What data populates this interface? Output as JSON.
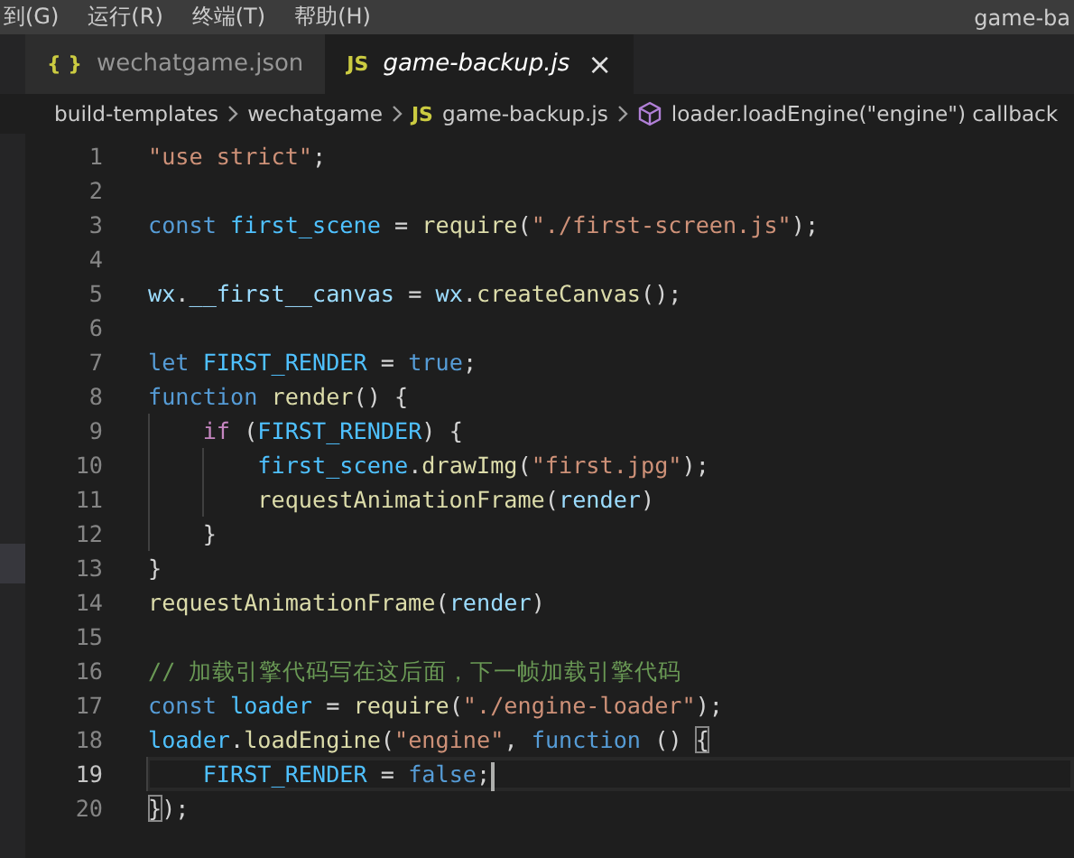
{
  "menu_bar": {
    "items": [
      "到(G)",
      "运行(R)",
      "终端(T)",
      "帮助(H)"
    ],
    "title": "game-ba"
  },
  "tabs": [
    {
      "icon": "{ }",
      "label": "wechatgame.json",
      "selected": false,
      "preview": false
    },
    {
      "icon": "JS",
      "label": "game-backup.js",
      "selected": true,
      "preview": true,
      "close": "×"
    }
  ],
  "breadcrumbs": [
    {
      "kind": "folder",
      "text": "build-templates"
    },
    {
      "kind": "folder",
      "text": "wechatgame"
    },
    {
      "kind": "file",
      "icon": "JS",
      "text": "game-backup.js"
    },
    {
      "kind": "symbol",
      "text": "loader.loadEngine(\"engine\") callback"
    }
  ],
  "editor": {
    "lines": [
      {
        "number": "1",
        "current": false,
        "tokens": [
          {
            "kind": "string",
            "text": "\"use strict\""
          },
          {
            "kind": "plain",
            "text": ";"
          }
        ]
      },
      {
        "number": "2",
        "current": false
      },
      {
        "number": "3",
        "current": false,
        "tokens": [
          {
            "kind": "keyword",
            "text": "const "
          },
          {
            "kind": "constant",
            "text": "first_scene"
          },
          {
            "kind": "plain",
            "text": " = "
          },
          {
            "kind": "function",
            "text": "require"
          },
          {
            "kind": "plain",
            "text": "("
          },
          {
            "kind": "string",
            "text": "\"./first-screen.js\""
          },
          {
            "kind": "plain",
            "text": ");"
          }
        ]
      },
      {
        "number": "4",
        "current": false
      },
      {
        "number": "5",
        "current": false,
        "tokens": [
          {
            "kind": "variable",
            "text": "wx"
          },
          {
            "kind": "plain",
            "text": "."
          },
          {
            "kind": "variable",
            "text": "__first__canvas"
          },
          {
            "kind": "plain",
            "text": " = "
          },
          {
            "kind": "variable",
            "text": "wx"
          },
          {
            "kind": "plain",
            "text": "."
          },
          {
            "kind": "function",
            "text": "createCanvas"
          },
          {
            "kind": "plain",
            "text": "();"
          }
        ]
      },
      {
        "number": "6",
        "current": false
      },
      {
        "number": "7",
        "current": false,
        "tokens": [
          {
            "kind": "keyword",
            "text": "let "
          },
          {
            "kind": "constant",
            "text": "FIRST_RENDER"
          },
          {
            "kind": "plain",
            "text": " = "
          },
          {
            "kind": "keyword",
            "text": "true"
          },
          {
            "kind": "plain",
            "text": ";"
          }
        ]
      },
      {
        "number": "8",
        "current": false,
        "tokens": [
          {
            "kind": "keyword",
            "text": "function "
          },
          {
            "kind": "function",
            "text": "render"
          },
          {
            "kind": "plain",
            "text": "() {"
          }
        ]
      },
      {
        "number": "9",
        "current": false,
        "tokens": [
          {
            "kind": "control",
            "text": "    if"
          },
          {
            "kind": "plain",
            "text": " ("
          },
          {
            "kind": "constant",
            "text": "FIRST_RENDER"
          },
          {
            "kind": "plain",
            "text": ") {"
          }
        ]
      },
      {
        "number": "10",
        "current": false,
        "tokens": [
          {
            "kind": "constant",
            "text": "        first_scene"
          },
          {
            "kind": "plain",
            "text": "."
          },
          {
            "kind": "function",
            "text": "drawImg"
          },
          {
            "kind": "plain",
            "text": "("
          },
          {
            "kind": "string",
            "text": "\"first.jpg\""
          },
          {
            "kind": "plain",
            "text": ");"
          }
        ]
      },
      {
        "number": "11",
        "current": false,
        "tokens": [
          {
            "kind": "function",
            "text": "        requestAnimationFrame"
          },
          {
            "kind": "plain",
            "text": "("
          },
          {
            "kind": "variable",
            "text": "render"
          },
          {
            "kind": "plain",
            "text": ")"
          }
        ]
      },
      {
        "number": "12",
        "current": false,
        "tokens": [
          {
            "kind": "plain",
            "text": "    }"
          }
        ]
      },
      {
        "number": "13",
        "current": false,
        "tokens": [
          {
            "kind": "plain",
            "text": "}"
          }
        ]
      },
      {
        "number": "14",
        "current": false,
        "tokens": [
          {
            "kind": "function",
            "text": "requestAnimationFrame"
          },
          {
            "kind": "plain",
            "text": "("
          },
          {
            "kind": "variable",
            "text": "render"
          },
          {
            "kind": "plain",
            "text": ")"
          }
        ]
      },
      {
        "number": "15",
        "current": false
      },
      {
        "number": "16",
        "current": false,
        "tokens": [
          {
            "kind": "comment",
            "text": "// 加载引擎代码写在这后面，下一帧加载引擎代码"
          }
        ]
      },
      {
        "number": "17",
        "current": false,
        "tokens": [
          {
            "kind": "keyword",
            "text": "const "
          },
          {
            "kind": "constant",
            "text": "loader"
          },
          {
            "kind": "plain",
            "text": " = "
          },
          {
            "kind": "function",
            "text": "require"
          },
          {
            "kind": "plain",
            "text": "("
          },
          {
            "kind": "string",
            "text": "\"./engine-loader\""
          },
          {
            "kind": "plain",
            "text": ");"
          }
        ]
      },
      {
        "number": "18",
        "current": false,
        "tokens": [
          {
            "kind": "constant",
            "text": "loader"
          },
          {
            "kind": "plain",
            "text": "."
          },
          {
            "kind": "function",
            "text": "loadEngine"
          },
          {
            "kind": "plain",
            "text": "("
          },
          {
            "kind": "string",
            "text": "\"engine\""
          },
          {
            "kind": "plain",
            "text": ", "
          },
          {
            "kind": "keyword",
            "text": "function"
          },
          {
            "kind": "plain",
            "text": " () "
          },
          {
            "kind": "match",
            "text": "{"
          }
        ]
      },
      {
        "number": "19",
        "current": true,
        "tokens": [
          {
            "kind": "constant",
            "text": "    FIRST_RENDER"
          },
          {
            "kind": "plain",
            "text": " = "
          },
          {
            "kind": "keyword",
            "text": "false"
          },
          {
            "kind": "plain",
            "text": ";"
          }
        ]
      },
      {
        "number": "20",
        "current": false,
        "tokens": [
          {
            "kind": "match",
            "text": "}"
          },
          {
            "kind": "plain",
            "text": ");"
          }
        ]
      }
    ]
  }
}
